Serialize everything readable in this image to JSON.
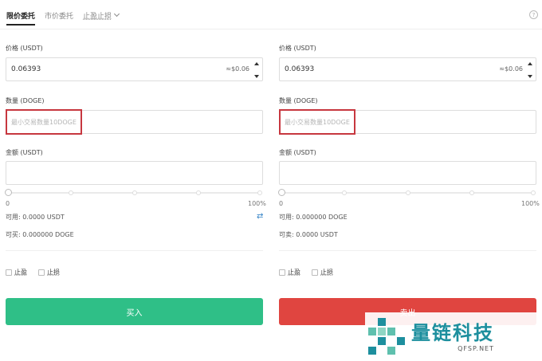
{
  "tabs": {
    "limit": "限价委托",
    "market": "市价委托",
    "stop": "止盈止损"
  },
  "help_icon": "?",
  "buy": {
    "price_label": "价格 (USDT)",
    "price_value": "0.06393",
    "price_approx": "≈$0.06",
    "qty_label": "数量 (DOGE)",
    "qty_placeholder": "最小交易数量10DOGE",
    "amount_label": "金额 (USDT)",
    "slider_min": "0",
    "slider_max": "100%",
    "slider_value_percent": 0,
    "available": "可用: 0.0000 USDT",
    "can_buy": "可买: 0.000000 DOGE",
    "take_profit": "止盈",
    "stop_loss": "止损",
    "button": "买入"
  },
  "sell": {
    "price_label": "价格 (USDT)",
    "price_value": "0.06393",
    "price_approx": "≈$0.06",
    "qty_label": "数量 (DOGE)",
    "qty_placeholder": "最小交易数量10DOGE",
    "amount_label": "金额 (USDT)",
    "slider_min": "0",
    "slider_max": "100%",
    "slider_value_percent": 0,
    "available": "可用: 0.000000 DOGE",
    "can_sell": "可卖: 0.0000 USDT",
    "take_profit": "止盈",
    "stop_loss": "止损",
    "button": "卖出"
  },
  "icons": {
    "swap": "swap-arrows-icon",
    "help": "question-circle-icon",
    "dropdown": "chevron-down-icon"
  },
  "colors": {
    "buy": "#2fbf87",
    "sell": "#e04540",
    "highlight": "#c7373f",
    "watermark": "#1d8f9e"
  },
  "watermark": {
    "title": "量链科技",
    "subtitle": "QFSP.NET"
  }
}
